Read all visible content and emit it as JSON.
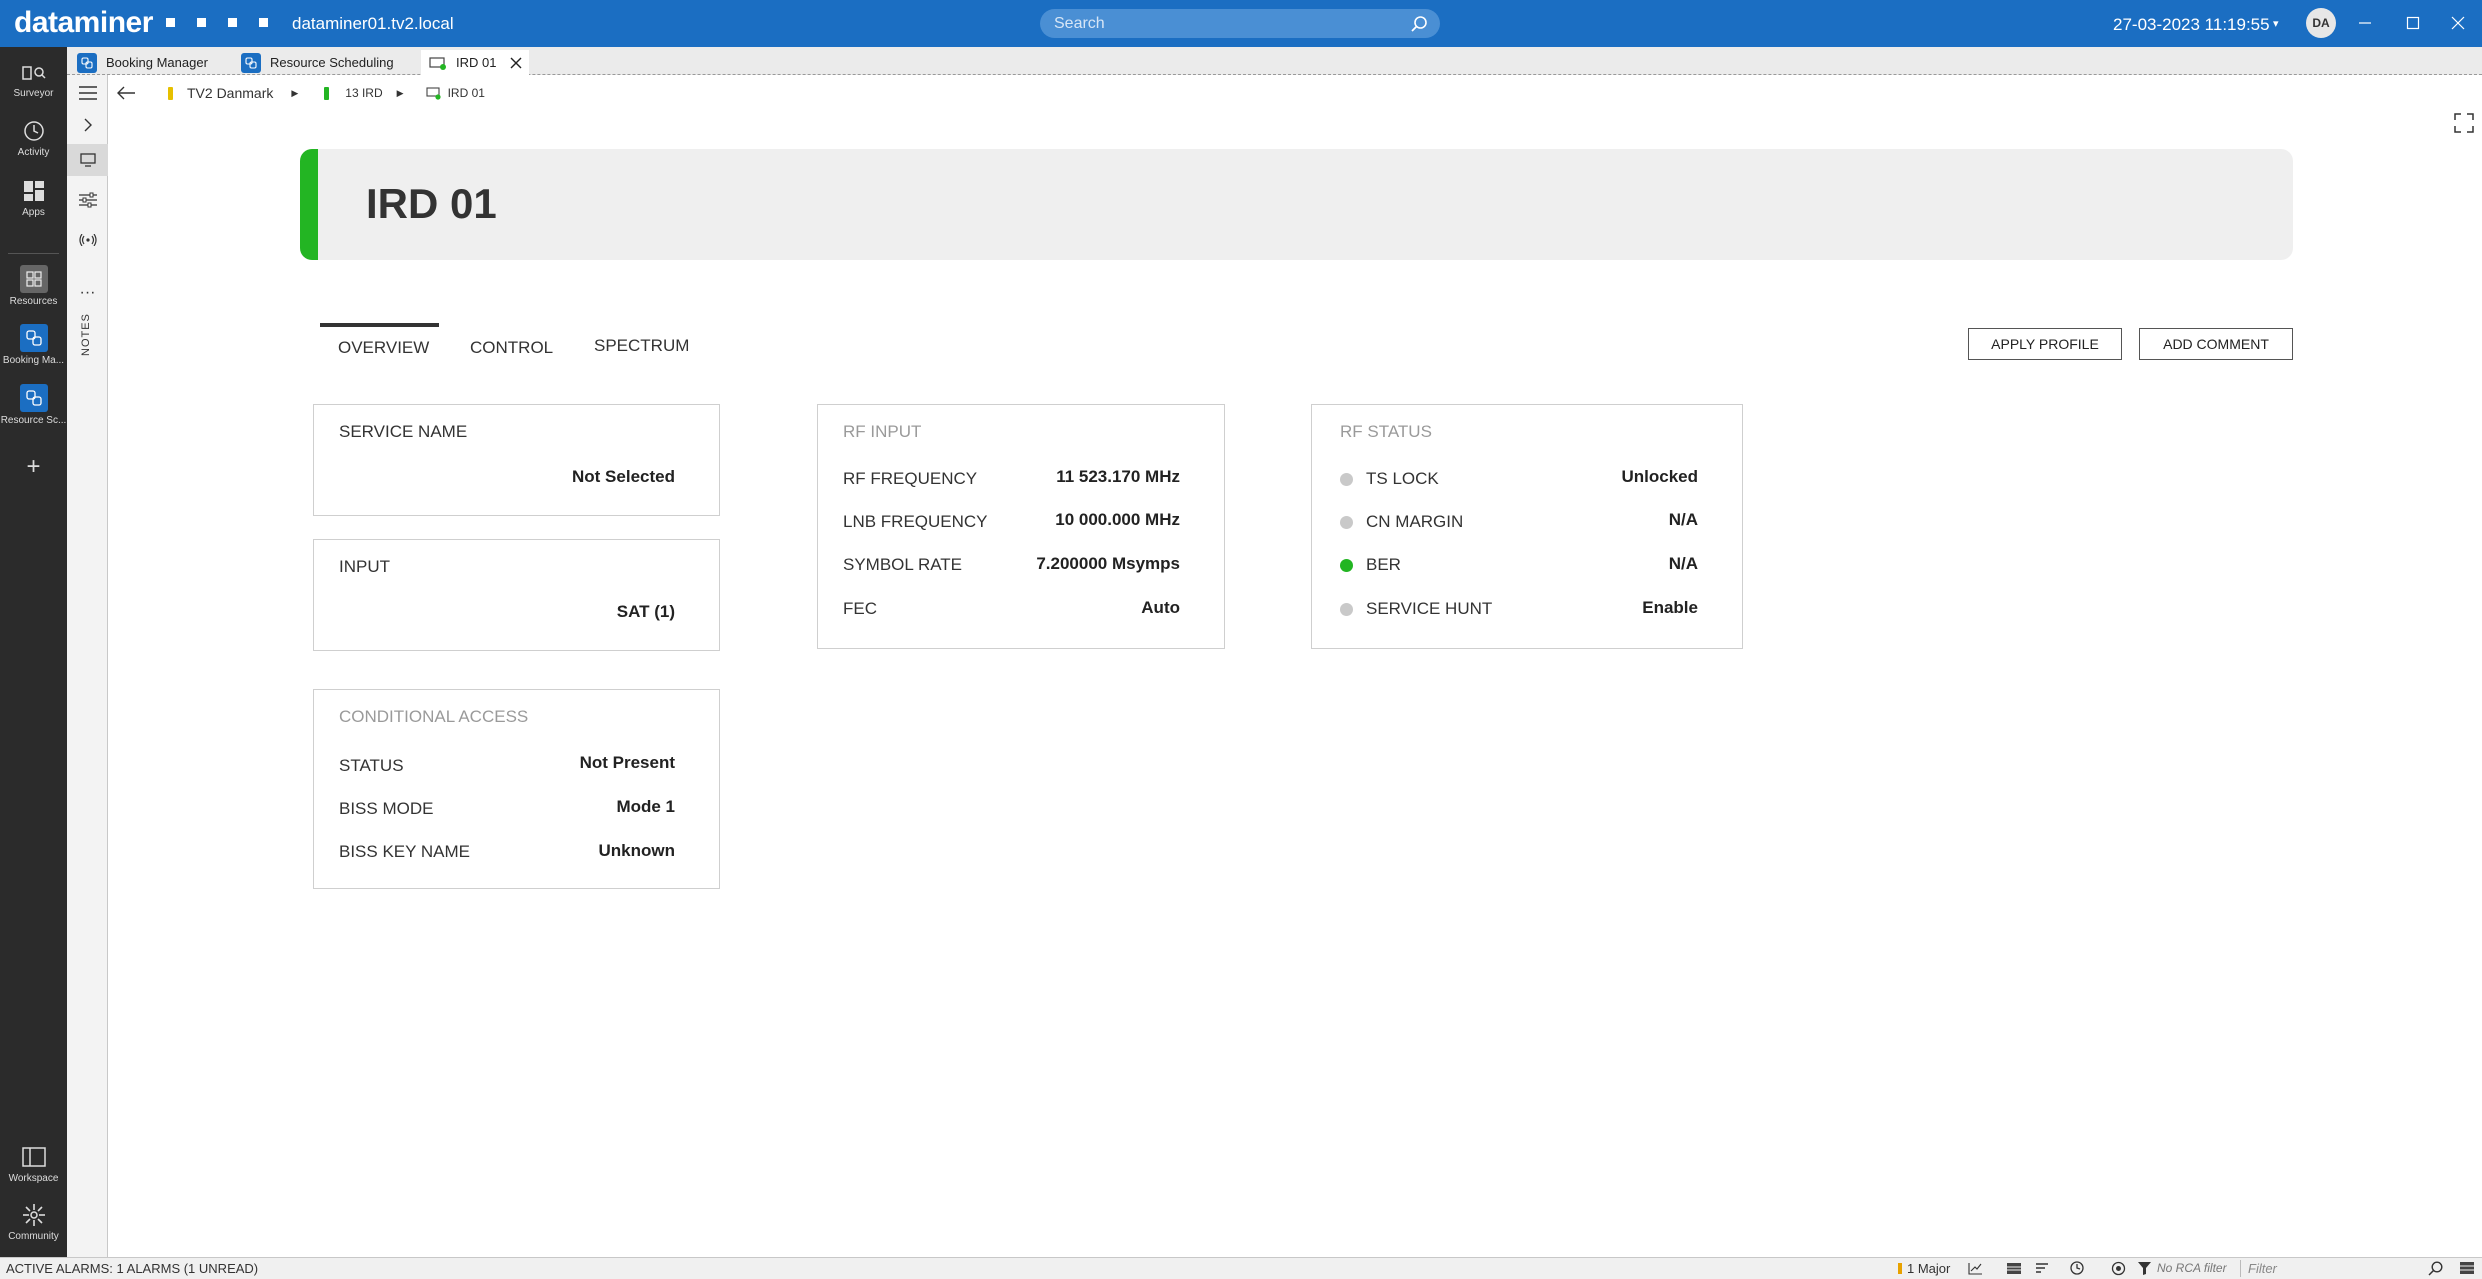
{
  "topbar": {
    "brand": "dataminer",
    "hostname": "dataminer01.tv2.local",
    "search_placeholder": "Search",
    "datetime": "27-03-2023 11:19:55",
    "avatar_initials": "DA",
    "accent_color": "#1b6ec2"
  },
  "rail": {
    "items": [
      {
        "label": "Surveyor",
        "icon": "surveyor-icon"
      },
      {
        "label": "Activity",
        "icon": "activity-icon"
      },
      {
        "label": "Apps",
        "icon": "apps-icon"
      },
      {
        "label": "Resources",
        "icon": "resources-icon"
      },
      {
        "label": "Booking Ma...",
        "icon": "booking-manager-icon"
      },
      {
        "label": "Resource Sc...",
        "icon": "resource-scheduling-icon"
      },
      {
        "label": "Workspace",
        "icon": "workspace-icon"
      },
      {
        "label": "Community",
        "icon": "community-icon"
      }
    ]
  },
  "tabs": [
    {
      "label": "Booking Manager"
    },
    {
      "label": "Resource Scheduling"
    },
    {
      "label": "IRD 01"
    }
  ],
  "side": {
    "notes_label": "NOTES"
  },
  "breadcrumb": {
    "items": [
      "TV2 Danmark",
      "13 IRD",
      "IRD 01"
    ]
  },
  "page": {
    "title": "IRD 01",
    "status_color": "#23b523"
  },
  "content_tabs": [
    "OVERVIEW",
    "CONTROL",
    "SPECTRUM"
  ],
  "actions": {
    "apply_profile": "APPLY PROFILE",
    "add_comment": "ADD COMMENT"
  },
  "service": {
    "title": "SERVICE NAME",
    "value": "Not Selected"
  },
  "input": {
    "title": "INPUT",
    "value": "SAT (1)"
  },
  "conditional_access": {
    "title": "CONDITIONAL ACCESS",
    "rows": [
      {
        "label": "STATUS",
        "value": "Not Present"
      },
      {
        "label": "BISS MODE",
        "value": "Mode 1"
      },
      {
        "label": "BISS KEY NAME",
        "value": "Unknown"
      }
    ]
  },
  "rf_input": {
    "title": "RF INPUT",
    "rows": [
      {
        "label": "RF FREQUENCY",
        "value": "11 523.170 MHz"
      },
      {
        "label": "LNB FREQUENCY",
        "value": "10 000.000 MHz"
      },
      {
        "label": "SYMBOL RATE",
        "value": "7.200000 Msymps"
      },
      {
        "label": "FEC",
        "value": "Auto"
      }
    ]
  },
  "rf_status": {
    "title": "RF STATUS",
    "rows": [
      {
        "label": "TS LOCK",
        "value": "Unlocked",
        "indicator": "grey"
      },
      {
        "label": "CN MARGIN",
        "value": "N/A",
        "indicator": "grey"
      },
      {
        "label": "BER",
        "value": "N/A",
        "indicator": "green"
      },
      {
        "label": "SERVICE HUNT",
        "value": "Enable",
        "indicator": "grey"
      }
    ]
  },
  "statusbar": {
    "alarms": "ACTIVE ALARMS: 1 ALARMS (1 UNREAD)",
    "major": "1 Major",
    "rca": "No RCA filter",
    "filter_placeholder": "Filter"
  }
}
